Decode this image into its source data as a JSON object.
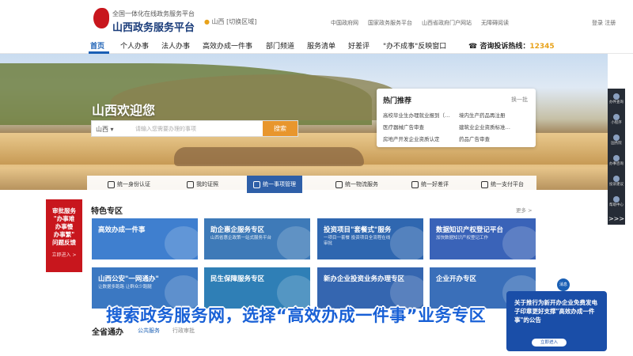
{
  "header": {
    "logo_sub": "全国一体化在线政务服务平台",
    "logo_title": "山西政务服务平台",
    "location": "山西",
    "location_sub": "[切换区域]",
    "links": [
      "中国政府网",
      "国家政务服务平台",
      "山西省政府门户网站",
      "无障碍阅读"
    ],
    "login": "登录  注册"
  },
  "nav": {
    "items": [
      "首页",
      "个人办事",
      "法人办事",
      "高效办成一件事",
      "部门频道",
      "服务清单",
      "好差评",
      "\"办不成事\"反映窗口"
    ],
    "active_index": 0,
    "hotline_label": "咨询投诉热线：",
    "hotline_number": "12345"
  },
  "hero": {
    "welcome": "山西欢迎您",
    "search_scope": "山西",
    "search_placeholder": "请输入您需要办理的事项",
    "search_button": "搜索"
  },
  "hot": {
    "title": "热门推荐",
    "change": "换一批",
    "items": [
      "高校毕业生办理就业报到（…",
      "境内生产药品再注册",
      "医疗器械广告审查",
      "建筑业企业资质标准…",
      "房地产开发企业资质认定",
      "药品广告审查"
    ]
  },
  "services": [
    "统一身份认证",
    "我的证照",
    "统一事项管理",
    "统一物流服务",
    "统一好差评",
    "统一支付平台"
  ],
  "services_active_index": 2,
  "review_banner": {
    "lines": [
      "审批服务",
      "\"办事难",
      "办事慢",
      "办事繁\"",
      "问题反馈"
    ],
    "go": "立即进入 >"
  },
  "section": {
    "title": "特色专区",
    "more": "更多 >"
  },
  "cards": [
    {
      "title": "高效办成一件事",
      "desc": "",
      "color": "#3f7fcf"
    },
    {
      "title": "助企惠企服务专区",
      "desc": "山西省惠企政策一站式服务平台",
      "color": "#3e7ab8"
    },
    {
      "title": "投资项目\"套餐式\"服务",
      "desc": "一项目一套餐 投资项目全流程在线审批",
      "color": "#2f67b0"
    },
    {
      "title": "数据知识产权登记平台",
      "desc": "加快数据知识产权登记工作",
      "color": "#3a63b8"
    },
    {
      "title": "山西公安\"一网通办\"",
      "desc": "让数据多跑路 让群众少跑腿",
      "color": "#3b78c2"
    },
    {
      "title": "民生保障服务专区",
      "desc": "",
      "color": "#2f7fb6"
    },
    {
      "title": "新办企业投资业务办理专区",
      "desc": "",
      "color": "#3566b0"
    },
    {
      "title": "企业开办专区",
      "desc": "",
      "color": "#3a6fb9"
    }
  ],
  "rail": [
    "办件查询",
    "小程序",
    "国务院",
    "办事咨询",
    "投诉建议",
    "帮助中心"
  ],
  "rail_more": ">>>",
  "bottom": {
    "title": "全省通办",
    "tab1": "公共服务",
    "tab2": "行政审批"
  },
  "notice": {
    "text": "关于推行为新开办企业免费发电子印章更好支撑\"高效办成一件事\"的公告",
    "button": "立即进入"
  },
  "bell": "消息",
  "caption": "搜索政务服务网，选择“高效办成一件事”业务专区"
}
